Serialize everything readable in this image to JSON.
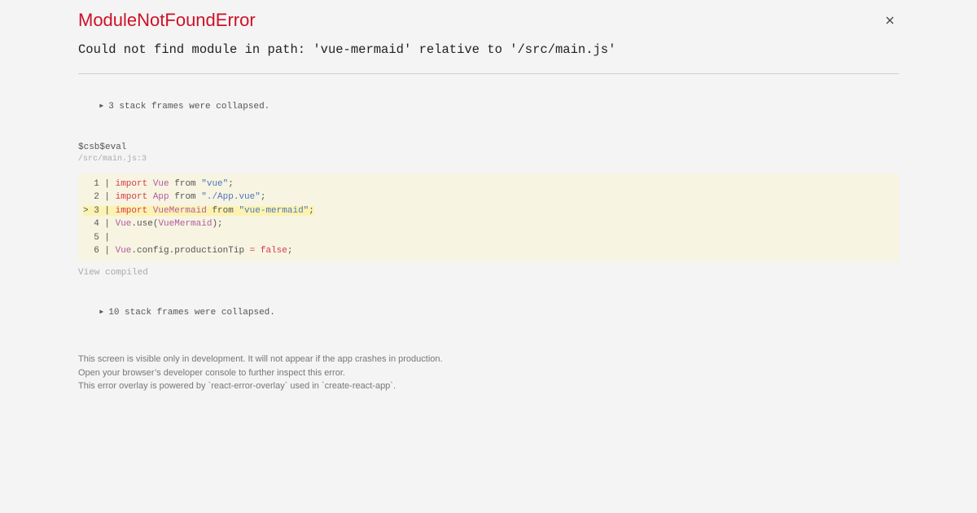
{
  "error": {
    "title": "ModuleNotFoundError",
    "message": "Could not find module in path: 'vue-mermaid' relative to '/src/main.js'"
  },
  "collapsed_top": {
    "icon": "triangle-right-icon",
    "label": "3 stack frames were collapsed."
  },
  "frame": {
    "function": "$csb$eval",
    "location": "/src/main.js:3"
  },
  "code": {
    "lines": [
      {
        "marker": " ",
        "num": "1",
        "tokens": [
          {
            "t": "import ",
            "c": "kw"
          },
          {
            "t": "Vue",
            "c": "id"
          },
          {
            "t": " from ",
            "c": ""
          },
          {
            "t": "\"vue\"",
            "c": "str"
          },
          {
            "t": ";",
            "c": ""
          }
        ]
      },
      {
        "marker": " ",
        "num": "2",
        "tokens": [
          {
            "t": "import ",
            "c": "kw"
          },
          {
            "t": "App",
            "c": "id"
          },
          {
            "t": " from ",
            "c": ""
          },
          {
            "t": "\"./App.vue\"",
            "c": "str"
          },
          {
            "t": ";",
            "c": ""
          }
        ]
      },
      {
        "marker": ">",
        "num": "3",
        "highlight": true,
        "tokens": [
          {
            "t": "import ",
            "c": "kw"
          },
          {
            "t": "VueMermaid",
            "c": "id"
          },
          {
            "t": " from ",
            "c": ""
          },
          {
            "t": "\"vue-mermaid\"",
            "c": "str"
          },
          {
            "t": ";",
            "c": ""
          }
        ]
      },
      {
        "marker": " ",
        "num": "4",
        "tokens": [
          {
            "t": "Vue",
            "c": "id"
          },
          {
            "t": ".use(",
            "c": ""
          },
          {
            "t": "VueMermaid",
            "c": "id"
          },
          {
            "t": ");",
            "c": ""
          }
        ]
      },
      {
        "marker": " ",
        "num": "5",
        "tokens": []
      },
      {
        "marker": " ",
        "num": "6",
        "tokens": [
          {
            "t": "Vue",
            "c": "id"
          },
          {
            "t": ".config.productionTip ",
            "c": ""
          },
          {
            "t": "=",
            "c": "kw"
          },
          {
            "t": " ",
            "c": ""
          },
          {
            "t": "false",
            "c": "kw"
          },
          {
            "t": ";",
            "c": ""
          }
        ]
      }
    ]
  },
  "view_compiled": "View compiled",
  "collapsed_bottom": {
    "icon": "triangle-right-icon",
    "label": "10 stack frames were collapsed."
  },
  "footer": {
    "line1": "This screen is visible only in development. It will not appear if the app crashes in production.",
    "line2": "Open your browser’s developer console to further inspect this error.",
    "line3": "This error overlay is powered by `react-error-overlay` used in `create-react-app`."
  },
  "colors": {
    "title": "#ce1126",
    "code_bg": "#f7f4e2",
    "highlight": "#fcf3b2",
    "background": "#f4f4f4"
  },
  "close_icon": "close-icon"
}
